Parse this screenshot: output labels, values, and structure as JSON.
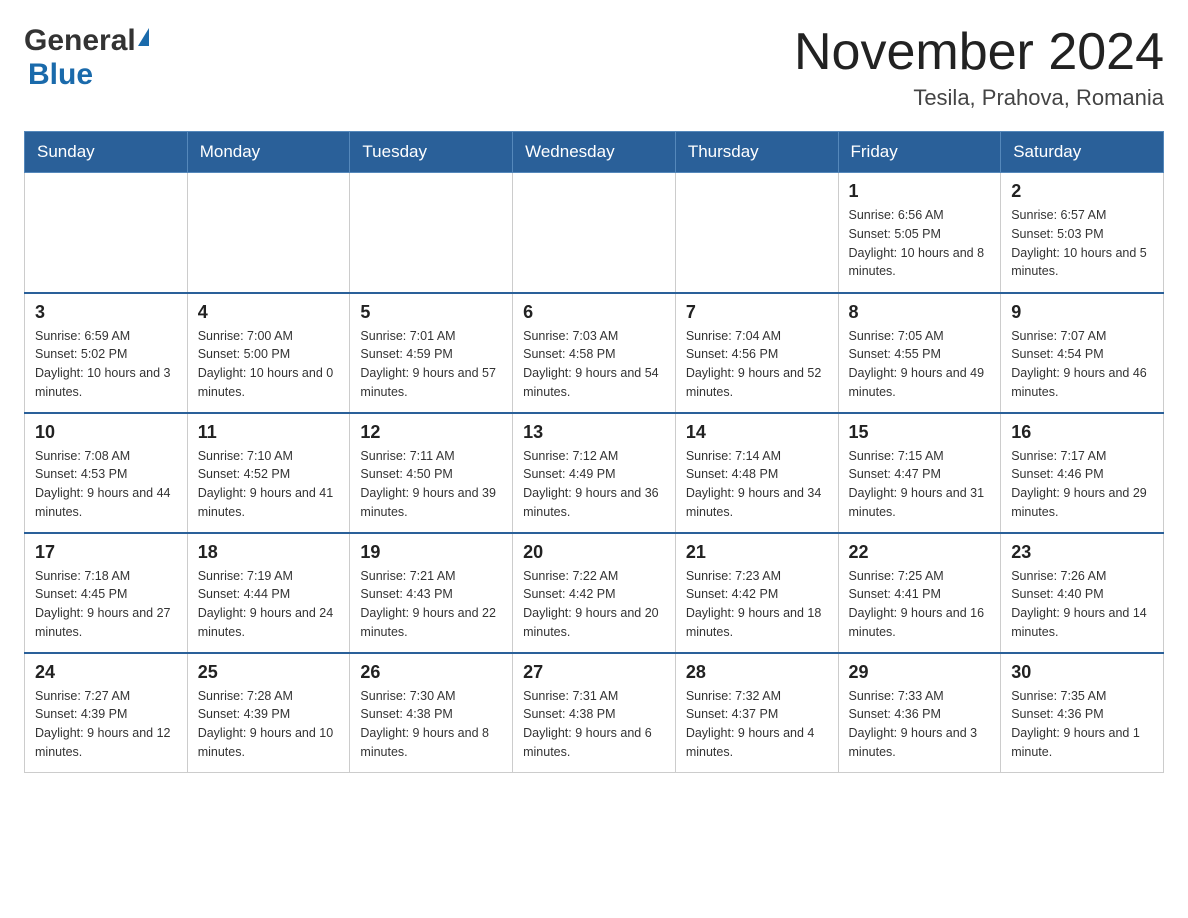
{
  "header": {
    "logo_text": "General",
    "logo_blue": "Blue",
    "month_title": "November 2024",
    "location": "Tesila, Prahova, Romania"
  },
  "days_of_week": [
    "Sunday",
    "Monday",
    "Tuesday",
    "Wednesday",
    "Thursday",
    "Friday",
    "Saturday"
  ],
  "weeks": [
    [
      {
        "day": "",
        "info": ""
      },
      {
        "day": "",
        "info": ""
      },
      {
        "day": "",
        "info": ""
      },
      {
        "day": "",
        "info": ""
      },
      {
        "day": "",
        "info": ""
      },
      {
        "day": "1",
        "info": "Sunrise: 6:56 AM\nSunset: 5:05 PM\nDaylight: 10 hours and 8 minutes."
      },
      {
        "day": "2",
        "info": "Sunrise: 6:57 AM\nSunset: 5:03 PM\nDaylight: 10 hours and 5 minutes."
      }
    ],
    [
      {
        "day": "3",
        "info": "Sunrise: 6:59 AM\nSunset: 5:02 PM\nDaylight: 10 hours and 3 minutes."
      },
      {
        "day": "4",
        "info": "Sunrise: 7:00 AM\nSunset: 5:00 PM\nDaylight: 10 hours and 0 minutes."
      },
      {
        "day": "5",
        "info": "Sunrise: 7:01 AM\nSunset: 4:59 PM\nDaylight: 9 hours and 57 minutes."
      },
      {
        "day": "6",
        "info": "Sunrise: 7:03 AM\nSunset: 4:58 PM\nDaylight: 9 hours and 54 minutes."
      },
      {
        "day": "7",
        "info": "Sunrise: 7:04 AM\nSunset: 4:56 PM\nDaylight: 9 hours and 52 minutes."
      },
      {
        "day": "8",
        "info": "Sunrise: 7:05 AM\nSunset: 4:55 PM\nDaylight: 9 hours and 49 minutes."
      },
      {
        "day": "9",
        "info": "Sunrise: 7:07 AM\nSunset: 4:54 PM\nDaylight: 9 hours and 46 minutes."
      }
    ],
    [
      {
        "day": "10",
        "info": "Sunrise: 7:08 AM\nSunset: 4:53 PM\nDaylight: 9 hours and 44 minutes."
      },
      {
        "day": "11",
        "info": "Sunrise: 7:10 AM\nSunset: 4:52 PM\nDaylight: 9 hours and 41 minutes."
      },
      {
        "day": "12",
        "info": "Sunrise: 7:11 AM\nSunset: 4:50 PM\nDaylight: 9 hours and 39 minutes."
      },
      {
        "day": "13",
        "info": "Sunrise: 7:12 AM\nSunset: 4:49 PM\nDaylight: 9 hours and 36 minutes."
      },
      {
        "day": "14",
        "info": "Sunrise: 7:14 AM\nSunset: 4:48 PM\nDaylight: 9 hours and 34 minutes."
      },
      {
        "day": "15",
        "info": "Sunrise: 7:15 AM\nSunset: 4:47 PM\nDaylight: 9 hours and 31 minutes."
      },
      {
        "day": "16",
        "info": "Sunrise: 7:17 AM\nSunset: 4:46 PM\nDaylight: 9 hours and 29 minutes."
      }
    ],
    [
      {
        "day": "17",
        "info": "Sunrise: 7:18 AM\nSunset: 4:45 PM\nDaylight: 9 hours and 27 minutes."
      },
      {
        "day": "18",
        "info": "Sunrise: 7:19 AM\nSunset: 4:44 PM\nDaylight: 9 hours and 24 minutes."
      },
      {
        "day": "19",
        "info": "Sunrise: 7:21 AM\nSunset: 4:43 PM\nDaylight: 9 hours and 22 minutes."
      },
      {
        "day": "20",
        "info": "Sunrise: 7:22 AM\nSunset: 4:42 PM\nDaylight: 9 hours and 20 minutes."
      },
      {
        "day": "21",
        "info": "Sunrise: 7:23 AM\nSunset: 4:42 PM\nDaylight: 9 hours and 18 minutes."
      },
      {
        "day": "22",
        "info": "Sunrise: 7:25 AM\nSunset: 4:41 PM\nDaylight: 9 hours and 16 minutes."
      },
      {
        "day": "23",
        "info": "Sunrise: 7:26 AM\nSunset: 4:40 PM\nDaylight: 9 hours and 14 minutes."
      }
    ],
    [
      {
        "day": "24",
        "info": "Sunrise: 7:27 AM\nSunset: 4:39 PM\nDaylight: 9 hours and 12 minutes."
      },
      {
        "day": "25",
        "info": "Sunrise: 7:28 AM\nSunset: 4:39 PM\nDaylight: 9 hours and 10 minutes."
      },
      {
        "day": "26",
        "info": "Sunrise: 7:30 AM\nSunset: 4:38 PM\nDaylight: 9 hours and 8 minutes."
      },
      {
        "day": "27",
        "info": "Sunrise: 7:31 AM\nSunset: 4:38 PM\nDaylight: 9 hours and 6 minutes."
      },
      {
        "day": "28",
        "info": "Sunrise: 7:32 AM\nSunset: 4:37 PM\nDaylight: 9 hours and 4 minutes."
      },
      {
        "day": "29",
        "info": "Sunrise: 7:33 AM\nSunset: 4:36 PM\nDaylight: 9 hours and 3 minutes."
      },
      {
        "day": "30",
        "info": "Sunrise: 7:35 AM\nSunset: 4:36 PM\nDaylight: 9 hours and 1 minute."
      }
    ]
  ]
}
